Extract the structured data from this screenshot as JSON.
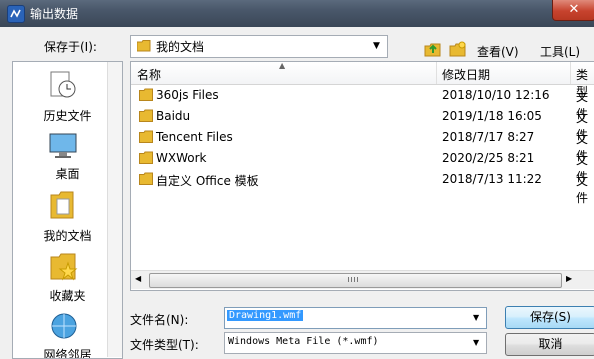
{
  "window": {
    "title": "输出数据",
    "close_label": "✕"
  },
  "save_in": {
    "label": "保存于(I):",
    "value": "我的文档"
  },
  "toolbar": {
    "view_label": "查看(V)",
    "tools_label": "工具(L)"
  },
  "places": [
    {
      "label": "历史文件",
      "icon": "history-icon"
    },
    {
      "label": "桌面",
      "icon": "desktop-icon"
    },
    {
      "label": "我的文档",
      "icon": "my-documents-icon"
    },
    {
      "label": "收藏夹",
      "icon": "favorites-icon"
    },
    {
      "label": "网络邻居",
      "icon": "network-icon"
    }
  ],
  "file_list": {
    "columns": {
      "name": "名称",
      "date": "修改日期",
      "type": "类型"
    },
    "rows": [
      {
        "name": "360js Files",
        "date": "2018/10/10 12:16",
        "type": "文件"
      },
      {
        "name": "Baidu",
        "date": "2019/1/18 16:05",
        "type": "文件"
      },
      {
        "name": "Tencent Files",
        "date": "2018/7/17 8:27",
        "type": "文件"
      },
      {
        "name": "WXWork",
        "date": "2020/2/25 8:21",
        "type": "文件"
      },
      {
        "name": "自定义 Office 模板",
        "date": "2018/7/13 11:22",
        "type": "文件"
      }
    ]
  },
  "filename": {
    "label": "文件名(N):",
    "value": "Drawing1.wmf"
  },
  "filetype": {
    "label": "文件类型(T):",
    "value": "Windows Meta File (*.wmf)"
  },
  "buttons": {
    "save": "保存(S)",
    "cancel": "取消"
  },
  "colors": {
    "folder": "#e8b931",
    "selection": "#3399ff",
    "title_bar": "#4a586b"
  }
}
